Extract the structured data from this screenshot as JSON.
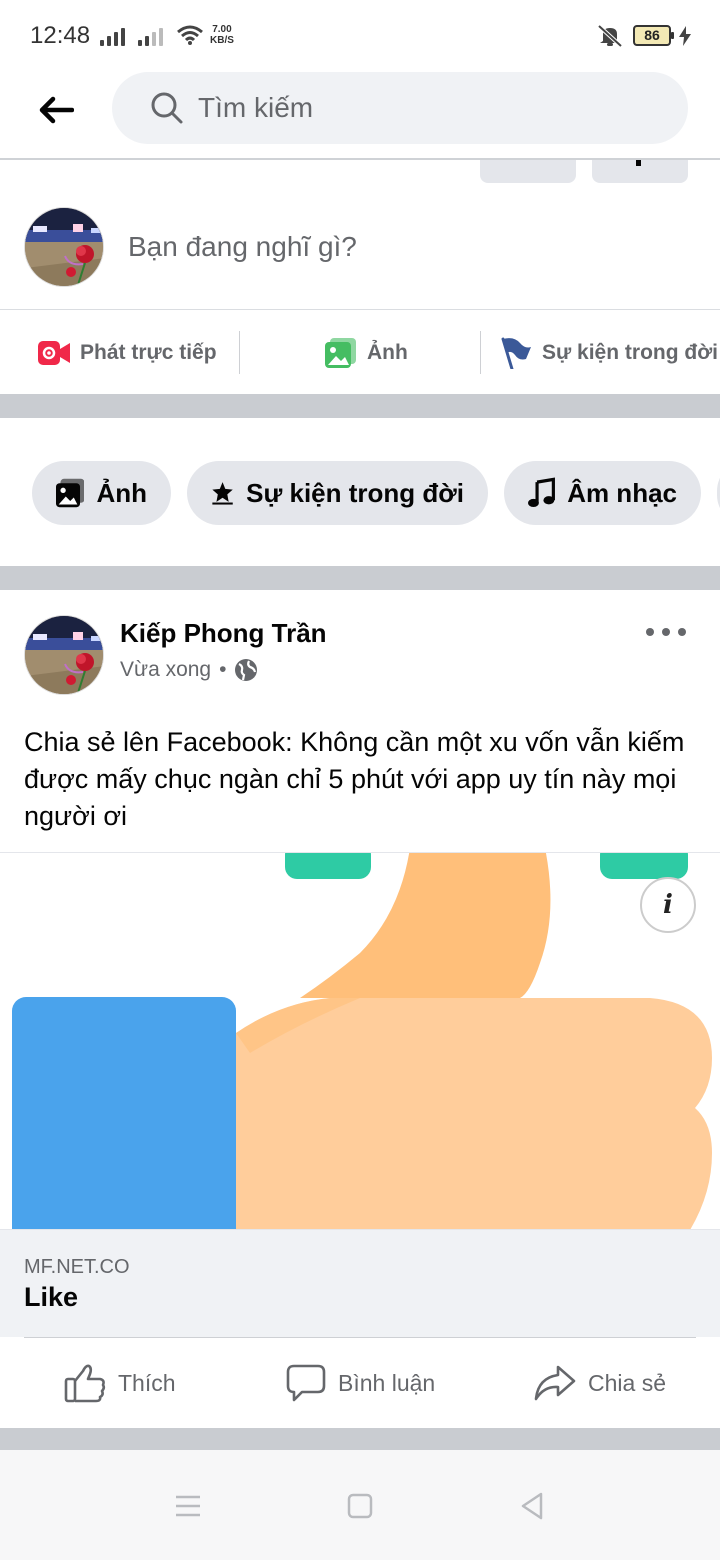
{
  "status_bar": {
    "time": "12:48",
    "speed_value": "7.00",
    "speed_unit": "KB/S",
    "battery": "86"
  },
  "search": {
    "placeholder": "Tìm kiếm"
  },
  "composer": {
    "prompt": "Bạn đang nghĩ gì?"
  },
  "composer_actions": [
    {
      "label": "Phát trực tiếp",
      "icon": "live-video-icon"
    },
    {
      "label": "Ảnh",
      "icon": "photo-icon"
    },
    {
      "label": "Sự kiện trong đời",
      "icon": "life-event-flag-icon"
    }
  ],
  "chips": [
    {
      "label": "Ảnh",
      "icon": "photo-icon"
    },
    {
      "label": "Sự kiện trong đời",
      "icon": "star-icon"
    },
    {
      "label": "Âm nhạc",
      "icon": "music-note-icon"
    }
  ],
  "post": {
    "author": "Kiếp Phong Trần",
    "time": "Vừa xong",
    "separator": "•",
    "audience_icon": "globe-icon",
    "text": "Chia sẻ lên Facebook: Không cần một xu vốn vẫn kiếm được mấy chục ngàn chỉ 5 phút với app uy tín này mọi người ơi",
    "info_glyph": "i",
    "link": {
      "domain": "MF.NET.CO",
      "title": "Like"
    },
    "actions": [
      {
        "label": "Thích",
        "icon": "like-thumb-icon"
      },
      {
        "label": "Bình luận",
        "icon": "comment-icon"
      },
      {
        "label": "Chia sẻ",
        "icon": "share-arrow-icon"
      }
    ]
  },
  "colors": {
    "live_red": "#f02849",
    "photo_green": "#45bd62",
    "flag_blue": "#3b5998",
    "thumb_blue": "#4aa3ec",
    "thumb_skin": "#ffcd9b",
    "thumb_dark": "#ffbf7a",
    "teal": "#2ecba4"
  }
}
